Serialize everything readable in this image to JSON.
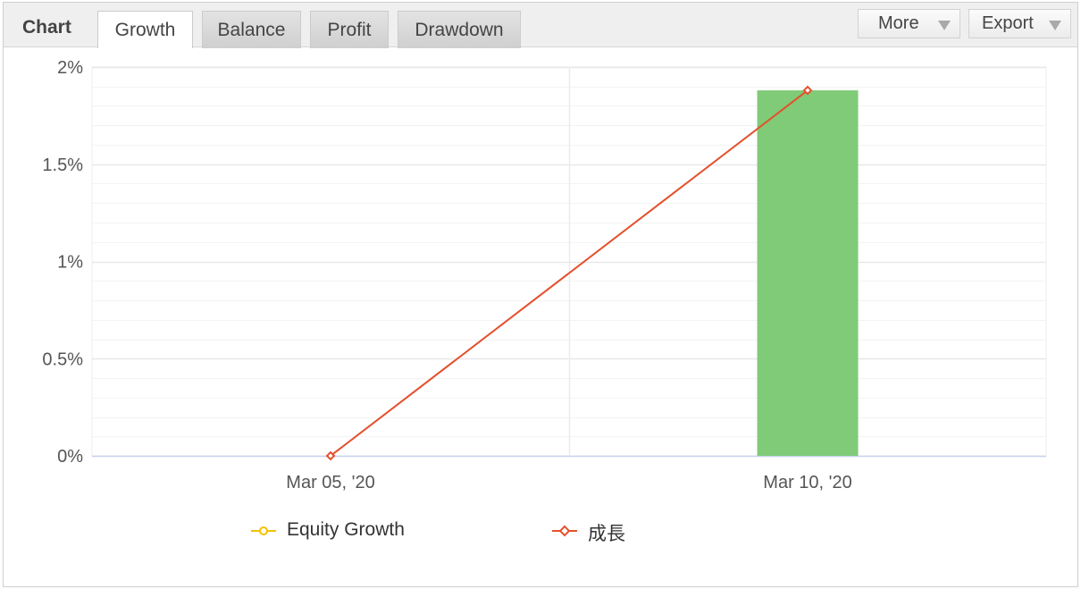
{
  "header": {
    "title": "Chart",
    "tabs": [
      {
        "label": "Growth",
        "active": true
      },
      {
        "label": "Balance",
        "active": false
      },
      {
        "label": "Profit",
        "active": false
      },
      {
        "label": "Drawdown",
        "active": false
      }
    ],
    "more_label": "More",
    "export_label": "Export"
  },
  "chart_data": {
    "type": "bar",
    "categories": [
      "Mar 05, '20",
      "Mar 10, '20"
    ],
    "y_ticks": [
      "0%",
      "0.5%",
      "1%",
      "1.5%",
      "2%"
    ],
    "ylim": [
      0,
      2
    ],
    "y_unit": "%",
    "grid": true,
    "legend_position": "bottom",
    "series": [
      {
        "name": "Equity Growth",
        "type": "line",
        "color": "#f2c200",
        "values": []
      },
      {
        "name": "成長",
        "type": "line",
        "color": "#e4502c",
        "values": [
          0,
          1.88
        ]
      },
      {
        "type": "bar",
        "color": "#7fcb77",
        "values": [
          0,
          1.88
        ]
      }
    ]
  },
  "colors": {
    "growth_line": "#e4502c",
    "equity_line": "#f2c200",
    "bar_fill": "#7fcb77",
    "grid": "#e8e8e8",
    "axis": "#c6d3ee"
  }
}
